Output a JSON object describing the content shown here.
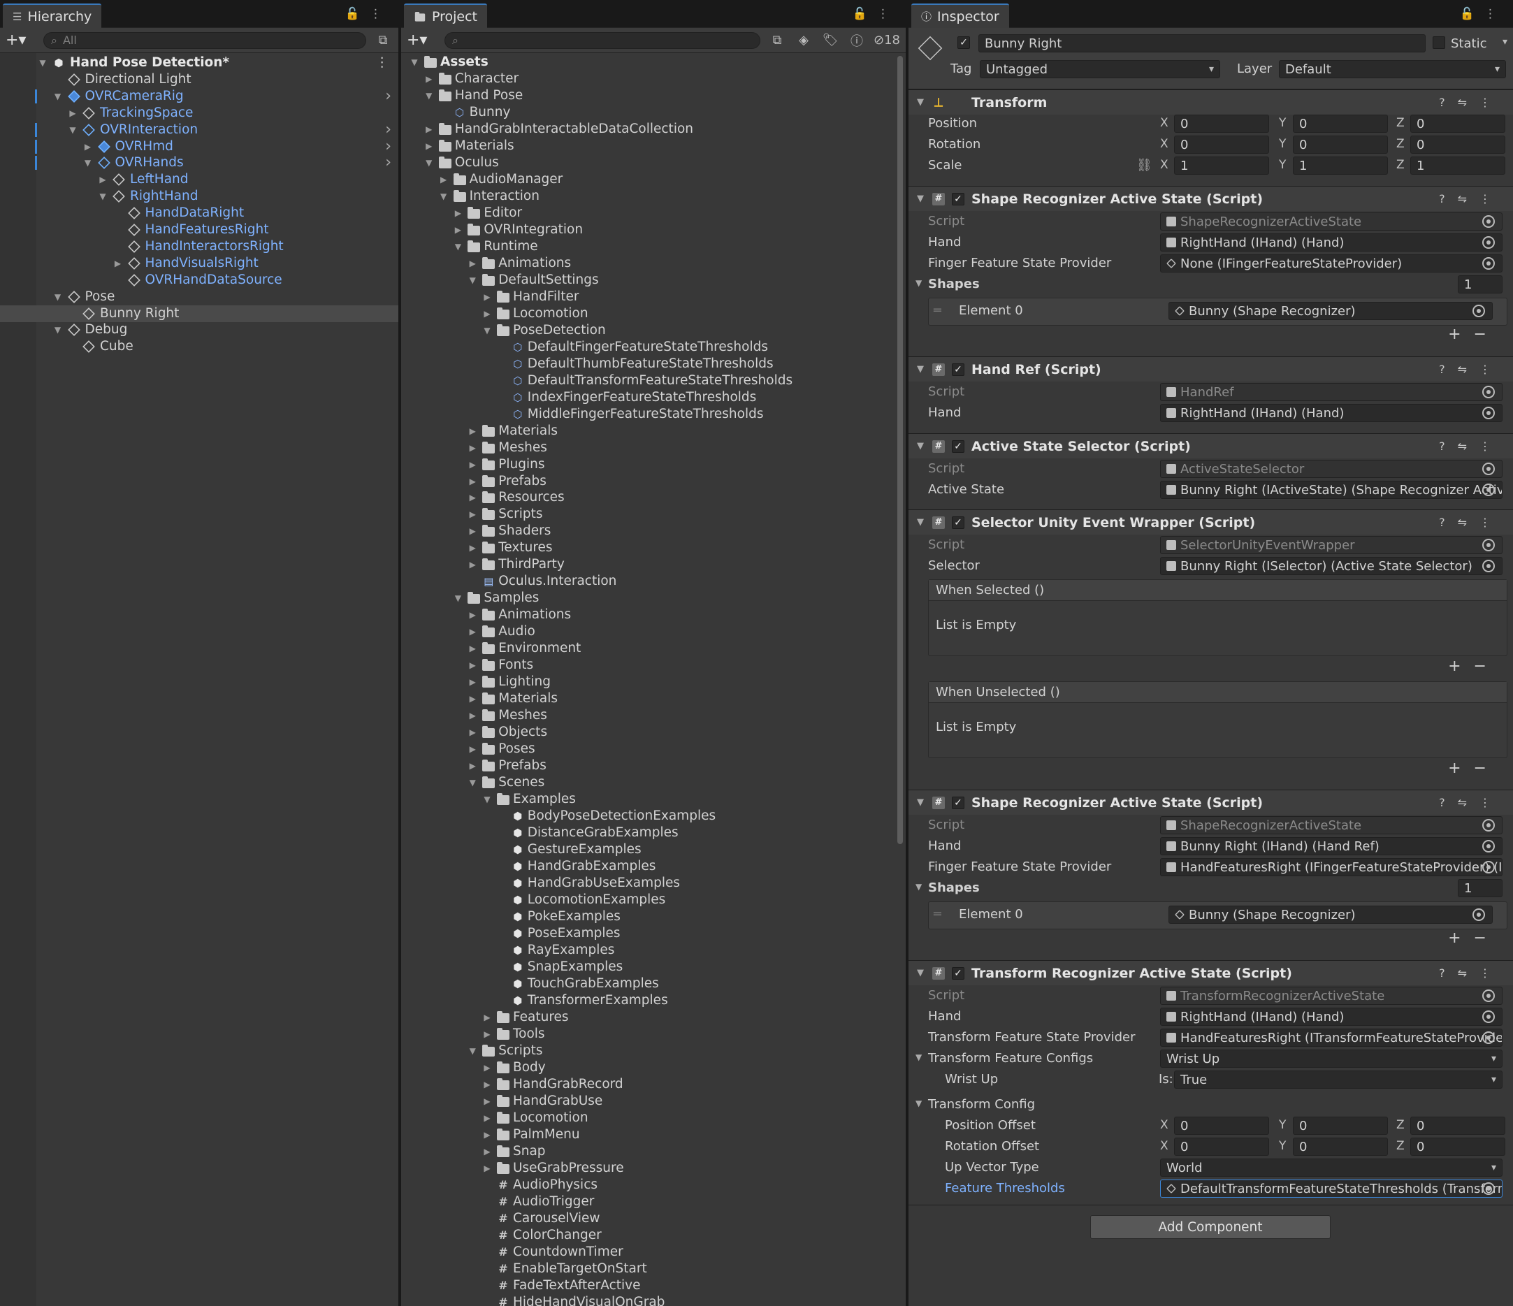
{
  "hierarchy": {
    "tab_label": "Hierarchy",
    "search_placeholder": "All",
    "rows": [
      {
        "label": "Hand Pose Detection*",
        "depth": 0,
        "expanded": true,
        "bold": true,
        "icon": "unity-scene-icon"
      },
      {
        "label": "Directional Light",
        "depth": 1,
        "icon": "gameobject-icon"
      },
      {
        "label": "OVRCameraRig",
        "depth": 1,
        "expanded": true,
        "prefab": true,
        "icon": "prefab-icon",
        "more": true
      },
      {
        "label": "TrackingSpace",
        "depth": 2,
        "collapsed": true,
        "prefab": true,
        "icon": "gameobject-icon"
      },
      {
        "label": "OVRInteraction",
        "depth": 2,
        "expanded": true,
        "prefab": true,
        "icon": "prefab-plus-icon",
        "more": true
      },
      {
        "label": "OVRHmd",
        "depth": 3,
        "collapsed": true,
        "prefab": true,
        "icon": "prefab-icon",
        "more": true
      },
      {
        "label": "OVRHands",
        "depth": 3,
        "expanded": true,
        "prefab": true,
        "icon": "prefab-plus-icon",
        "more": true
      },
      {
        "label": "LeftHand",
        "depth": 4,
        "collapsed": true,
        "prefab": true,
        "icon": "gameobject-icon"
      },
      {
        "label": "RightHand",
        "depth": 4,
        "expanded": true,
        "prefab": true,
        "icon": "gameobject-icon"
      },
      {
        "label": "HandDataRight",
        "depth": 5,
        "prefab": true,
        "icon": "gameobject-icon"
      },
      {
        "label": "HandFeaturesRight",
        "depth": 5,
        "prefab": true,
        "icon": "gameobject-icon"
      },
      {
        "label": "HandInteractorsRight",
        "depth": 5,
        "prefab": true,
        "icon": "gameobject-icon"
      },
      {
        "label": "HandVisualsRight",
        "depth": 5,
        "collapsed": true,
        "prefab": true,
        "icon": "gameobject-icon"
      },
      {
        "label": "OVRHandDataSource",
        "depth": 5,
        "prefab": true,
        "icon": "gameobject-icon"
      },
      {
        "label": "Pose",
        "depth": 1,
        "expanded": true,
        "icon": "gameobject-icon"
      },
      {
        "label": "Bunny Right",
        "depth": 2,
        "selected": true,
        "icon": "gameobject-icon"
      },
      {
        "label": "Debug",
        "depth": 1,
        "expanded": true,
        "icon": "gameobject-icon"
      },
      {
        "label": "Cube",
        "depth": 2,
        "icon": "gameobject-icon"
      }
    ]
  },
  "project": {
    "tab_label": "Project",
    "hidden_count": "18",
    "rows": [
      {
        "label": "Assets",
        "depth": 0,
        "expanded": true,
        "bold": true,
        "icon": "folder-open-icon"
      },
      {
        "label": "Character",
        "depth": 1,
        "collapsed": true,
        "icon": "folder-icon"
      },
      {
        "label": "Hand Pose",
        "depth": 1,
        "expanded": true,
        "icon": "folder-open-icon"
      },
      {
        "label": "Bunny",
        "depth": 2,
        "icon": "shape-recognizer-icon"
      },
      {
        "label": "HandGrabInteractableDataCollection",
        "depth": 1,
        "collapsed": true,
        "icon": "folder-icon"
      },
      {
        "label": "Materials",
        "depth": 1,
        "collapsed": true,
        "icon": "folder-icon"
      },
      {
        "label": "Oculus",
        "depth": 1,
        "expanded": true,
        "icon": "folder-open-icon"
      },
      {
        "label": "AudioManager",
        "depth": 2,
        "collapsed": true,
        "icon": "folder-icon"
      },
      {
        "label": "Interaction",
        "depth": 2,
        "expanded": true,
        "icon": "folder-open-icon"
      },
      {
        "label": "Editor",
        "depth": 3,
        "collapsed": true,
        "icon": "folder-icon"
      },
      {
        "label": "OVRIntegration",
        "depth": 3,
        "collapsed": true,
        "icon": "folder-icon"
      },
      {
        "label": "Runtime",
        "depth": 3,
        "expanded": true,
        "icon": "folder-open-icon"
      },
      {
        "label": "Animations",
        "depth": 4,
        "collapsed": true,
        "icon": "folder-icon"
      },
      {
        "label": "DefaultSettings",
        "depth": 4,
        "expanded": true,
        "icon": "folder-open-icon"
      },
      {
        "label": "HandFilter",
        "depth": 5,
        "collapsed": true,
        "icon": "folder-icon"
      },
      {
        "label": "Locomotion",
        "depth": 5,
        "collapsed": true,
        "icon": "folder-icon"
      },
      {
        "label": "PoseDetection",
        "depth": 5,
        "expanded": true,
        "icon": "folder-open-icon"
      },
      {
        "label": "DefaultFingerFeatureStateThresholds",
        "depth": 6,
        "icon": "thresholds-asset-icon"
      },
      {
        "label": "DefaultThumbFeatureStateThresholds",
        "depth": 6,
        "icon": "thresholds-asset-icon"
      },
      {
        "label": "DefaultTransformFeatureStateThresholds",
        "depth": 6,
        "icon": "thresholds-asset-icon"
      },
      {
        "label": "IndexFingerFeatureStateThresholds",
        "depth": 6,
        "icon": "thresholds-asset-icon"
      },
      {
        "label": "MiddleFingerFeatureStateThresholds",
        "depth": 6,
        "icon": "thresholds-asset-icon"
      },
      {
        "label": "Materials",
        "depth": 4,
        "collapsed": true,
        "icon": "folder-icon"
      },
      {
        "label": "Meshes",
        "depth": 4,
        "collapsed": true,
        "icon": "folder-icon"
      },
      {
        "label": "Plugins",
        "depth": 4,
        "collapsed": true,
        "icon": "folder-icon"
      },
      {
        "label": "Prefabs",
        "depth": 4,
        "collapsed": true,
        "icon": "folder-icon"
      },
      {
        "label": "Resources",
        "depth": 4,
        "collapsed": true,
        "icon": "folder-icon"
      },
      {
        "label": "Scripts",
        "depth": 4,
        "collapsed": true,
        "icon": "folder-icon"
      },
      {
        "label": "Shaders",
        "depth": 4,
        "collapsed": true,
        "icon": "folder-icon"
      },
      {
        "label": "Textures",
        "depth": 4,
        "collapsed": true,
        "icon": "folder-icon"
      },
      {
        "label": "ThirdParty",
        "depth": 4,
        "collapsed": true,
        "icon": "folder-icon"
      },
      {
        "label": "Oculus.Interaction",
        "depth": 4,
        "icon": "assembly-definition-icon"
      },
      {
        "label": "Samples",
        "depth": 3,
        "expanded": true,
        "icon": "folder-open-icon"
      },
      {
        "label": "Animations",
        "depth": 4,
        "collapsed": true,
        "icon": "folder-icon"
      },
      {
        "label": "Audio",
        "depth": 4,
        "collapsed": true,
        "icon": "folder-icon"
      },
      {
        "label": "Environment",
        "depth": 4,
        "collapsed": true,
        "icon": "folder-icon"
      },
      {
        "label": "Fonts",
        "depth": 4,
        "collapsed": true,
        "icon": "folder-icon"
      },
      {
        "label": "Lighting",
        "depth": 4,
        "collapsed": true,
        "icon": "folder-icon"
      },
      {
        "label": "Materials",
        "depth": 4,
        "collapsed": true,
        "icon": "folder-icon"
      },
      {
        "label": "Meshes",
        "depth": 4,
        "collapsed": true,
        "icon": "folder-icon"
      },
      {
        "label": "Objects",
        "depth": 4,
        "collapsed": true,
        "icon": "folder-icon"
      },
      {
        "label": "Poses",
        "depth": 4,
        "collapsed": true,
        "icon": "folder-icon"
      },
      {
        "label": "Prefabs",
        "depth": 4,
        "collapsed": true,
        "icon": "folder-icon"
      },
      {
        "label": "Scenes",
        "depth": 4,
        "expanded": true,
        "icon": "folder-open-icon"
      },
      {
        "label": "Examples",
        "depth": 5,
        "expanded": true,
        "icon": "folder-open-icon"
      },
      {
        "label": "BodyPoseDetectionExamples",
        "depth": 6,
        "icon": "unity-scene-icon"
      },
      {
        "label": "DistanceGrabExamples",
        "depth": 6,
        "icon": "unity-scene-icon"
      },
      {
        "label": "GestureExamples",
        "depth": 6,
        "icon": "unity-scene-icon"
      },
      {
        "label": "HandGrabExamples",
        "depth": 6,
        "icon": "unity-scene-icon"
      },
      {
        "label": "HandGrabUseExamples",
        "depth": 6,
        "icon": "unity-scene-icon"
      },
      {
        "label": "LocomotionExamples",
        "depth": 6,
        "icon": "unity-scene-icon"
      },
      {
        "label": "PokeExamples",
        "depth": 6,
        "icon": "unity-scene-icon"
      },
      {
        "label": "PoseExamples",
        "depth": 6,
        "icon": "unity-scene-icon"
      },
      {
        "label": "RayExamples",
        "depth": 6,
        "icon": "unity-scene-icon"
      },
      {
        "label": "SnapExamples",
        "depth": 6,
        "icon": "unity-scene-icon"
      },
      {
        "label": "TouchGrabExamples",
        "depth": 6,
        "icon": "unity-scene-icon"
      },
      {
        "label": "TransformerExamples",
        "depth": 6,
        "icon": "unity-scene-icon"
      },
      {
        "label": "Features",
        "depth": 5,
        "collapsed": true,
        "icon": "folder-icon"
      },
      {
        "label": "Tools",
        "depth": 5,
        "collapsed": true,
        "icon": "folder-icon"
      },
      {
        "label": "Scripts",
        "depth": 4,
        "expanded": true,
        "icon": "folder-open-icon"
      },
      {
        "label": "Body",
        "depth": 5,
        "collapsed": true,
        "icon": "folder-icon"
      },
      {
        "label": "HandGrabRecord",
        "depth": 5,
        "collapsed": true,
        "icon": "folder-icon"
      },
      {
        "label": "HandGrabUse",
        "depth": 5,
        "collapsed": true,
        "icon": "folder-icon"
      },
      {
        "label": "Locomotion",
        "depth": 5,
        "collapsed": true,
        "icon": "folder-icon"
      },
      {
        "label": "PalmMenu",
        "depth": 5,
        "collapsed": true,
        "icon": "folder-icon"
      },
      {
        "label": "Snap",
        "depth": 5,
        "collapsed": true,
        "icon": "folder-icon"
      },
      {
        "label": "UseGrabPressure",
        "depth": 5,
        "collapsed": true,
        "icon": "folder-icon"
      },
      {
        "label": "AudioPhysics",
        "depth": 5,
        "icon": "csharp-script-icon"
      },
      {
        "label": "AudioTrigger",
        "depth": 5,
        "icon": "csharp-script-icon"
      },
      {
        "label": "CarouselView",
        "depth": 5,
        "icon": "csharp-script-icon"
      },
      {
        "label": "ColorChanger",
        "depth": 5,
        "icon": "csharp-script-icon"
      },
      {
        "label": "CountdownTimer",
        "depth": 5,
        "icon": "csharp-script-icon"
      },
      {
        "label": "EnableTargetOnStart",
        "depth": 5,
        "icon": "csharp-script-icon"
      },
      {
        "label": "FadeTextAfterActive",
        "depth": 5,
        "icon": "csharp-script-icon"
      },
      {
        "label": "HideHandVisualOnGrab",
        "depth": 5,
        "icon": "csharp-script-icon"
      }
    ]
  },
  "inspector": {
    "tab_label": "Inspector",
    "object_name": "Bunny Right",
    "static_label": "Static",
    "tag_label": "Tag",
    "tag_value": "Untagged",
    "layer_label": "Layer",
    "layer_value": "Default",
    "transform": {
      "title": "Transform",
      "position_label": "Position",
      "position": [
        "0",
        "0",
        "0"
      ],
      "rotation_label": "Rotation",
      "rotation": [
        "0",
        "0",
        "0"
      ],
      "scale_label": "Scale",
      "scale": [
        "1",
        "1",
        "1"
      ]
    },
    "axis": [
      "X",
      "Y",
      "Z"
    ],
    "script_label": "Script",
    "hand_label": "Hand",
    "comp1": {
      "title": "Shape Recognizer Active State (Script)",
      "script": "ShapeRecognizerActiveState",
      "hand": "RightHand (IHand) (Hand)",
      "ffsp_label": "Finger Feature State Provider",
      "ffsp": "None (IFingerFeatureStateProvider)",
      "shapes_label": "Shapes",
      "shapes_count": "1",
      "element_label": "Element 0",
      "element": "Bunny (Shape Recognizer)"
    },
    "comp2": {
      "title": "Hand Ref (Script)",
      "script": "HandRef",
      "hand": "RightHand (IHand) (Hand)"
    },
    "comp3": {
      "title": "Active State Selector (Script)",
      "script": "ActiveStateSelector",
      "active_state_label": "Active State",
      "active_state": "Bunny Right (IActiveState) (Shape Recognizer Active State)"
    },
    "comp4": {
      "title": "Selector Unity Event Wrapper (Script)",
      "script": "SelectorUnityEventWrapper",
      "selector_label": "Selector",
      "selector": "Bunny Right (ISelector) (Active State Selector)",
      "when_selected": "When Selected ()",
      "when_unselected": "When Unselected ()",
      "list_empty": "List is Empty"
    },
    "comp5": {
      "title": "Shape Recognizer Active State (Script)",
      "script": "ShapeRecognizerActiveState",
      "hand": "Bunny Right (IHand) (Hand Ref)",
      "ffsp_label": "Finger Feature State Provider",
      "ffsp": "HandFeaturesRight (IFingerFeatureStateProvider) (I",
      "shapes_label": "Shapes",
      "shapes_count": "1",
      "element_label": "Element 0",
      "element": "Bunny (Shape Recognizer)"
    },
    "comp6": {
      "title": "Transform Recognizer Active State (Script)",
      "script": "TransformRecognizerActiveState",
      "hand": "RightHand (IHand) (Hand)",
      "tfsp_label": "Transform Feature State Provider",
      "tfsp": "HandFeaturesRight (ITransformFeatureStateProvide",
      "tfc_label": "Transform Feature Configs",
      "tfc": "Wrist Up",
      "wrist_up_label": "Wrist Up",
      "is_label": "Is:",
      "is_value": "True",
      "tconfig_label": "Transform Config",
      "pos_offset_label": "Position Offset",
      "pos_offset": [
        "0",
        "0",
        "0"
      ],
      "rot_offset_label": "Rotation Offset",
      "rot_offset": [
        "0",
        "0",
        "0"
      ],
      "up_vector_label": "Up Vector Type",
      "up_vector": "World",
      "thresholds_label": "Feature Thresholds",
      "thresholds": "DefaultTransformFeatureStateThresholds (Transform"
    },
    "add_component": "Add Component"
  },
  "colors": {
    "accent": "#3b86d8",
    "prefab_text": "#7fb2ff",
    "panel_bg": "#383838"
  }
}
